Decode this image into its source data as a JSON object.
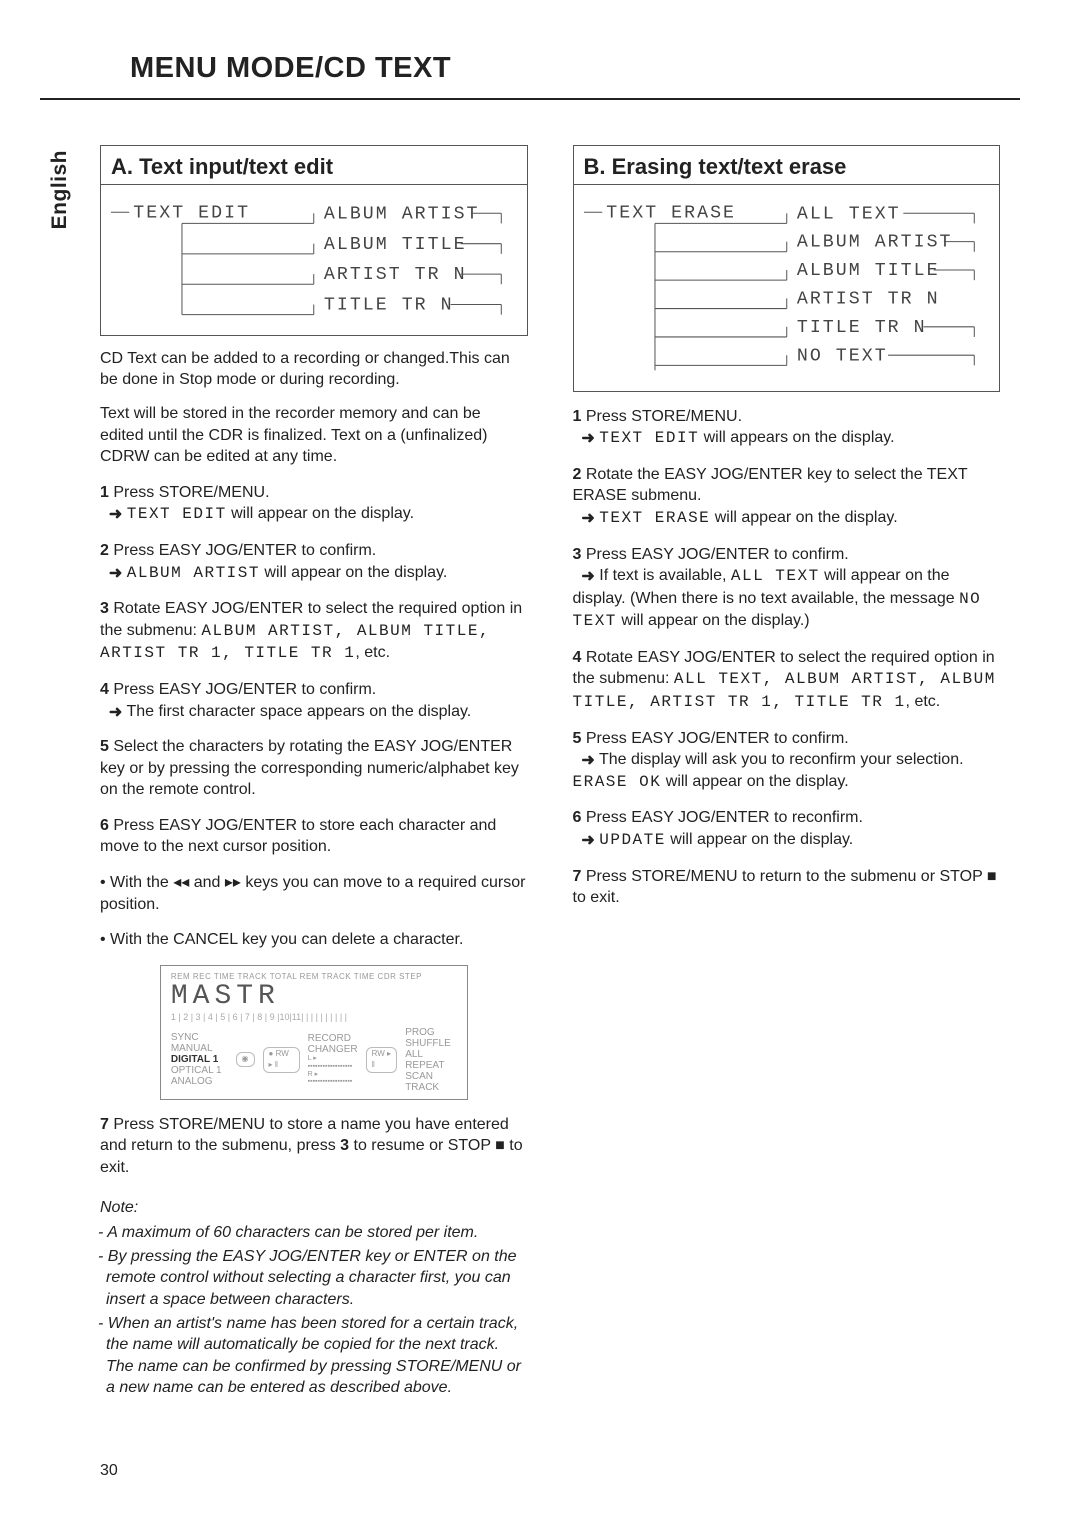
{
  "page": {
    "title": "MENU MODE/CD TEXT",
    "language": "English",
    "number": "30"
  },
  "sectionA": {
    "heading": "A. Text input/text edit",
    "tree_root": "TEXT EDIT",
    "tree_items": [
      "ALBUM ARTIST",
      "ALBUM TITLE",
      "ARTIST TR N",
      "TITLE TR N"
    ],
    "p1": "CD Text can be added to a recording or changed.This can be done in Stop mode or during recording.",
    "p2": "Text will be stored in the recorder memory and can be edited until the CDR is finalized. Text on a (unfinalized) CDRW can be edited at any time.",
    "s1a": "Press STORE/MENU.",
    "s1b_seg": "TEXT EDIT",
    "s1b_tail": " will appear on the display.",
    "s2a": "Press EASY JOG/ENTER to confirm.",
    "s2b_seg": "ALBUM ARTIST",
    "s2b_tail": " will appear on the display.",
    "s3a": "Rotate EASY JOG/ENTER to select the required option in the submenu: ",
    "s3_list_seg": "ALBUM ARTIST, ALBUM TITLE, ARTIST TR  1, TITLE TR  1",
    "s3_tail": ", etc.",
    "s4a": "Press EASY JOG/ENTER to confirm.",
    "s4b": "The first character space appears on the display.",
    "s5": "Select the characters by rotating the EASY JOG/ENTER key or by pressing the corresponding numeric/alphabet key on the remote control.",
    "s6": "Press EASY JOG/ENTER to store each character and move to the next cursor position.",
    "bullet1_a": "With the ",
    "bullet1_b": " and ",
    "bullet1_c": " keys you can move to a required cursor position.",
    "bullet2": "With the CANCEL key you can delete a character.",
    "display": {
      "top_labels": "REM   REC   TIME  TRACK        TOTAL  REM   TRACK   TIME              CDR    STEP",
      "main": "MASTR",
      "segline": "1 | 2 | 3 | 4 | 5 | 6 | 7 | 8 | 9 |10|11| | | | | | | | | |",
      "left1": "SYNC MANUAL",
      "left2": "DIGITAL 1",
      "left3": "OPTICAL 1",
      "left4": "ANALOG",
      "mid1": "RECORD",
      "mid2": "CHANGER",
      "rw": "RW",
      "right1": "PROG",
      "right2": "SHUFFLE   ALL",
      "right3": "REPEAT",
      "right4": "SCAN   TRACK"
    },
    "s7_a": "Press STORE/MENU to store a name you have entered and return to the submenu, press ",
    "s7_b": " to resume or STOP ■ to exit.",
    "note_head": "Note:",
    "notes": [
      "A maximum of 60 characters can be stored per item.",
      "By pressing the EASY JOG/ENTER key or ENTER on the remote control without selecting a character first, you can insert a space between characters.",
      "When an artist's name has been stored for a certain track, the name will automatically be copied for the next track. The name can be confirmed by pressing STORE/MENU or a new name can be entered as described above."
    ]
  },
  "sectionB": {
    "heading": "B. Erasing text/text erase",
    "tree_root": "TEXT ERASE",
    "tree_items": [
      "ALL TEXT",
      "ALBUM ARTIST",
      "ALBUM TITLE",
      "ARTIST TR N",
      "TITLE TR N",
      "NO TEXT"
    ],
    "s1a": "Press STORE/MENU.",
    "s1b_seg": "TEXT EDIT",
    "s1b_tail": " will appears on the display.",
    "s2a": "Rotate the EASY JOG/ENTER key to select the TEXT ERASE submenu.",
    "s2b_seg": "TEXT ERASE",
    "s2b_tail": " will appear on the display.",
    "s3a": "Press EASY JOG/ENTER to confirm.",
    "s3b_pre": "If text is available, ",
    "s3b_seg": "ALL TEXT",
    "s3b_mid": " will appear on the display. (When there is no text available, the message ",
    "s3b_seg2": "NO TEXT",
    "s3b_tail": " will appear on the display.)",
    "s4a": "Rotate EASY JOG/ENTER to select the required option in the submenu: ",
    "s4_list_seg": "ALL  TEXT, ALBUM ARTIST, ALBUM TITLE, ARTIST TR  1, TITLE TR  1",
    "s4_tail": ", etc.",
    "s5a": "Press EASY JOG/ENTER to confirm.",
    "s5b": "The display will ask you to reconfirm your selection. ",
    "s5b_seg": "ERASE OK",
    "s5b_tail": " will appear on the display.",
    "s6a": "Press EASY JOG/ENTER to reconfirm.",
    "s6b_seg": "UPDATE",
    "s6b_tail": " will appear on the display.",
    "s7": "Press STORE/MENU to return to the submenu or STOP ■ to exit."
  }
}
